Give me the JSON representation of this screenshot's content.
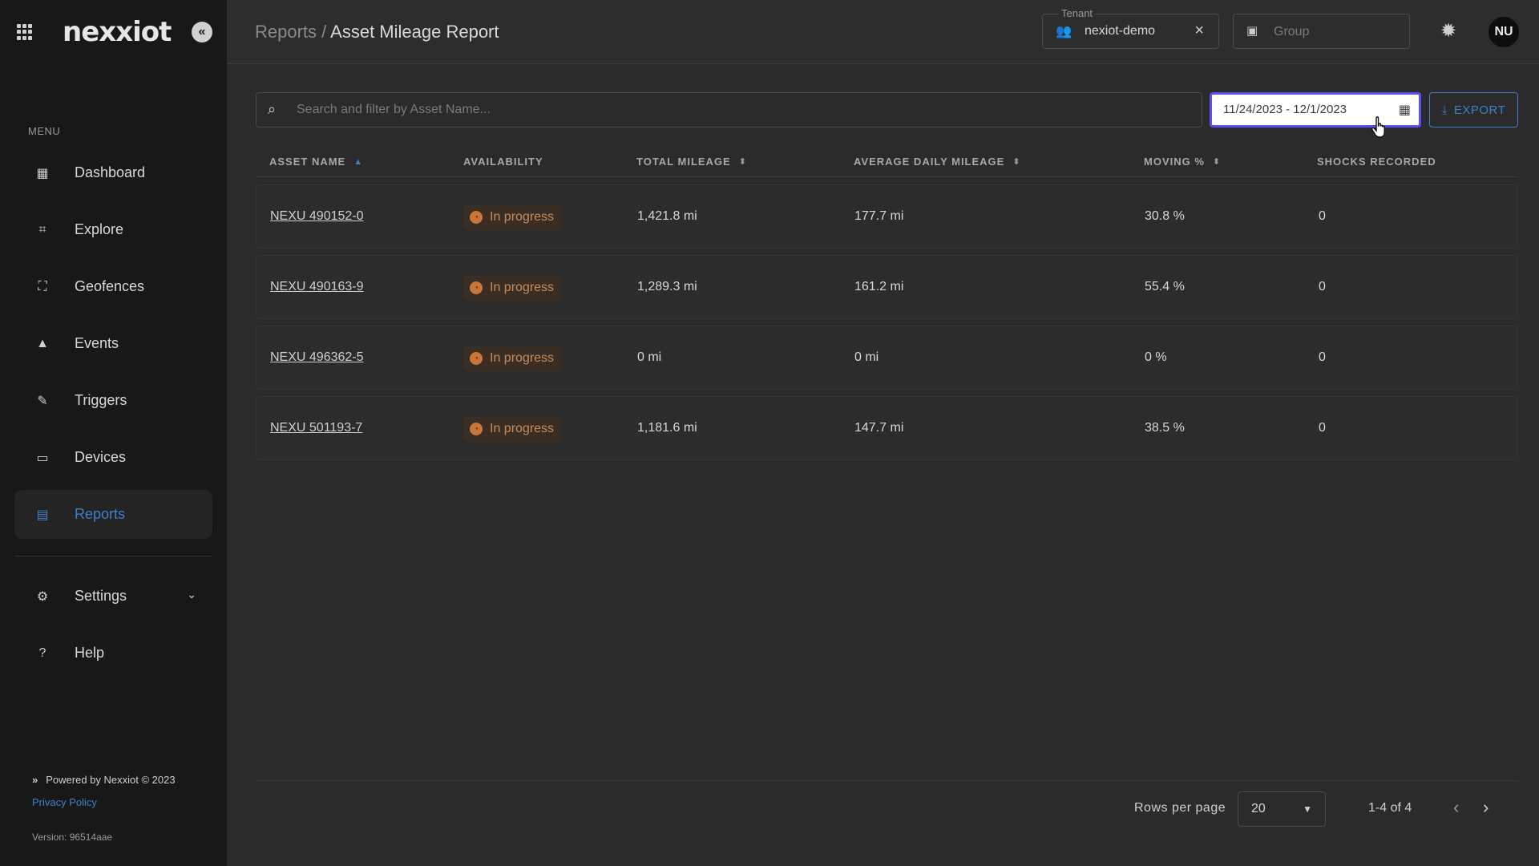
{
  "sidebar": {
    "logo": "nexxiot",
    "menu_label": "MENU",
    "items": [
      {
        "label": "Dashboard",
        "icon": "map-icon"
      },
      {
        "label": "Explore",
        "icon": "binoculars-icon"
      },
      {
        "label": "Geofences",
        "icon": "geofence-icon"
      },
      {
        "label": "Events",
        "icon": "warning-icon"
      },
      {
        "label": "Triggers",
        "icon": "pencil-icon"
      },
      {
        "label": "Devices",
        "icon": "cast-icon"
      },
      {
        "label": "Reports",
        "icon": "document-icon",
        "active": true
      }
    ],
    "settings_label": "Settings",
    "help_label": "Help",
    "powered_by": "Powered by Nexxiot © 2023",
    "privacy_policy": "Privacy Policy",
    "version": "Version: 96514aae"
  },
  "header": {
    "breadcrumb_parent": "Reports",
    "breadcrumb_sep": " / ",
    "title": "Asset Mileage Report",
    "tenant_label": "Tenant",
    "tenant_value": "nexiot-demo",
    "group_placeholder": "Group",
    "avatar_initials": "NU"
  },
  "toolbar": {
    "search_placeholder": "Search and filter by Asset Name...",
    "date_range": "11/24/2023 - 12/1/2023",
    "export_label": "EXPORT"
  },
  "table": {
    "columns": [
      "ASSET NAME",
      "AVAILABILITY",
      "TOTAL MILEAGE",
      "AVERAGE DAILY MILEAGE",
      "MOVING %",
      "SHOCKS RECORDED"
    ],
    "rows": [
      {
        "asset": "NEXU 490152-0",
        "availability": "In progress",
        "total": "1,421.8 mi",
        "avg": "177.7 mi",
        "moving": "30.8 %",
        "shocks": "0"
      },
      {
        "asset": "NEXU 490163-9",
        "availability": "In progress",
        "total": "1,289.3 mi",
        "avg": "161.2 mi",
        "moving": "55.4 %",
        "shocks": "0"
      },
      {
        "asset": "NEXU 496362-5",
        "availability": "In progress",
        "total": "0 mi",
        "avg": "0 mi",
        "moving": "0 %",
        "shocks": "0"
      },
      {
        "asset": "NEXU 501193-7",
        "availability": "In progress",
        "total": "1,181.6 mi",
        "avg": "147.7 mi",
        "moving": "38.5 %",
        "shocks": "0"
      }
    ]
  },
  "pagination": {
    "rows_per_page_label": "Rows per page",
    "rows_per_page": "20",
    "range": "1-4 of 4"
  },
  "colors": {
    "accent": "#3f7fc9",
    "focus": "#5b4ff0",
    "status_in_progress": "#c9753a"
  }
}
